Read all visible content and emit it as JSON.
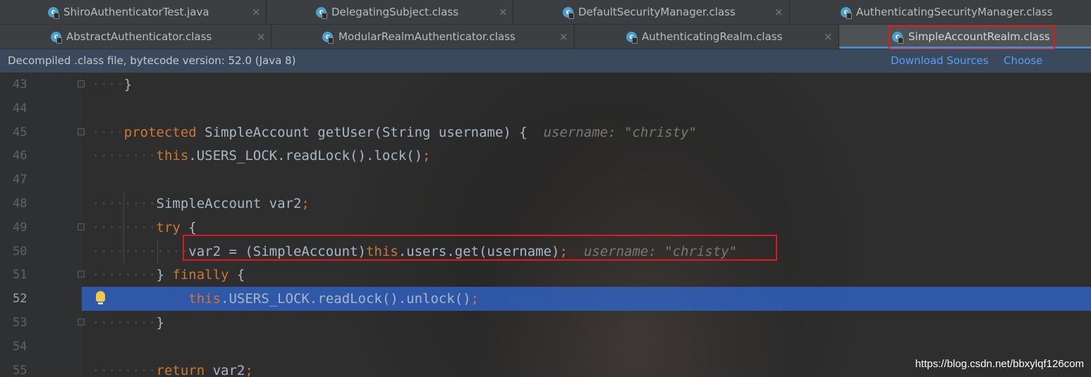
{
  "tabs_row1": [
    {
      "label": "ShiroAuthenticatorTest.java",
      "icon": "java-class-icon",
      "closable": true
    },
    {
      "label": "DelegatingSubject.class",
      "icon": "class-file-icon",
      "closable": true
    },
    {
      "label": "DefaultSecurityManager.class",
      "icon": "class-file-icon",
      "closable": true
    },
    {
      "label": "AuthenticatingSecurityManager.class",
      "icon": "class-file-icon",
      "closable": false
    }
  ],
  "tabs_row2": [
    {
      "label": "AbstractAuthenticator.class",
      "icon": "class-file-icon",
      "closable": true
    },
    {
      "label": "ModularRealmAuthenticator.class",
      "icon": "class-file-icon",
      "closable": true
    },
    {
      "label": "AuthenticatingRealm.class",
      "icon": "class-file-icon",
      "closable": true
    },
    {
      "label": "SimpleAccountRealm.class",
      "icon": "class-file-icon",
      "closable": false,
      "active": true
    }
  ],
  "close_glyph": "×",
  "infobar": {
    "text": "Decompiled .class file, bytecode version: 52.0 (Java 8)",
    "download_sources": "Download Sources",
    "choose_sources": "Choose Sources..."
  },
  "lines": [
    {
      "num": "43",
      "dots": "····",
      "parts": [
        {
          "t": "}",
          "c": "p"
        }
      ]
    },
    {
      "num": "44",
      "dots": "",
      "parts": []
    },
    {
      "num": "45",
      "dots": "····",
      "parts": [
        {
          "t": "protected",
          "c": "kw"
        },
        {
          "t": " SimpleAccount getUser(String username) {  ",
          "c": "p"
        },
        {
          "t": "username: \"christy\"",
          "c": "hint"
        }
      ]
    },
    {
      "num": "46",
      "dots": "········",
      "parts": [
        {
          "t": "this",
          "c": "kw"
        },
        {
          "t": ".USERS_LOCK.readLock().lock()",
          "c": "p"
        },
        {
          "t": ";",
          "c": "kw"
        }
      ]
    },
    {
      "num": "47",
      "dots": "",
      "parts": []
    },
    {
      "num": "48",
      "dots": "········",
      "parts": [
        {
          "t": "SimpleAccount var2",
          "c": "p"
        },
        {
          "t": ";",
          "c": "kw"
        }
      ]
    },
    {
      "num": "49",
      "dots": "········",
      "parts": [
        {
          "t": "try",
          "c": "kw"
        },
        {
          "t": " {",
          "c": "p"
        }
      ]
    },
    {
      "num": "50",
      "dots": "············",
      "parts": [
        {
          "t": "var2 = (SimpleAccount)",
          "c": "p"
        },
        {
          "t": "this",
          "c": "kw"
        },
        {
          "t": ".users.get(username)",
          "c": "p"
        },
        {
          "t": ";",
          "c": "kw"
        },
        {
          "t": "  ",
          "c": "p"
        },
        {
          "t": "username: \"christy\"",
          "c": "hint"
        }
      ]
    },
    {
      "num": "51",
      "dots": "········",
      "parts": [
        {
          "t": "} ",
          "c": "p"
        },
        {
          "t": "finally",
          "c": "kw"
        },
        {
          "t": " {",
          "c": "p"
        }
      ]
    },
    {
      "num": "52",
      "dots": "            ",
      "parts": [
        {
          "t": "this",
          "c": "kw"
        },
        {
          "t": ".USERS_LOCK.readLock().unlock()",
          "c": "p"
        },
        {
          "t": ";",
          "c": "kw"
        }
      ],
      "highlight": true,
      "bulb": true
    },
    {
      "num": "53",
      "dots": "········",
      "parts": [
        {
          "t": "}",
          "c": "p"
        }
      ]
    },
    {
      "num": "54",
      "dots": "",
      "parts": []
    },
    {
      "num": "55",
      "dots": "········",
      "parts": [
        {
          "t": "return",
          "c": "kw"
        },
        {
          "t": " var2",
          "c": "p"
        },
        {
          "t": ";",
          "c": "kw"
        }
      ]
    }
  ],
  "watermark": "https://blog.csdn.net/bbxylqf126com",
  "colors": {
    "keyword": "#cc7832",
    "plain": "#a9b7c6",
    "hint": "#787878",
    "highlight": "#2f65ca",
    "link": "#589df6",
    "annotation_box": "#e01a1a"
  }
}
